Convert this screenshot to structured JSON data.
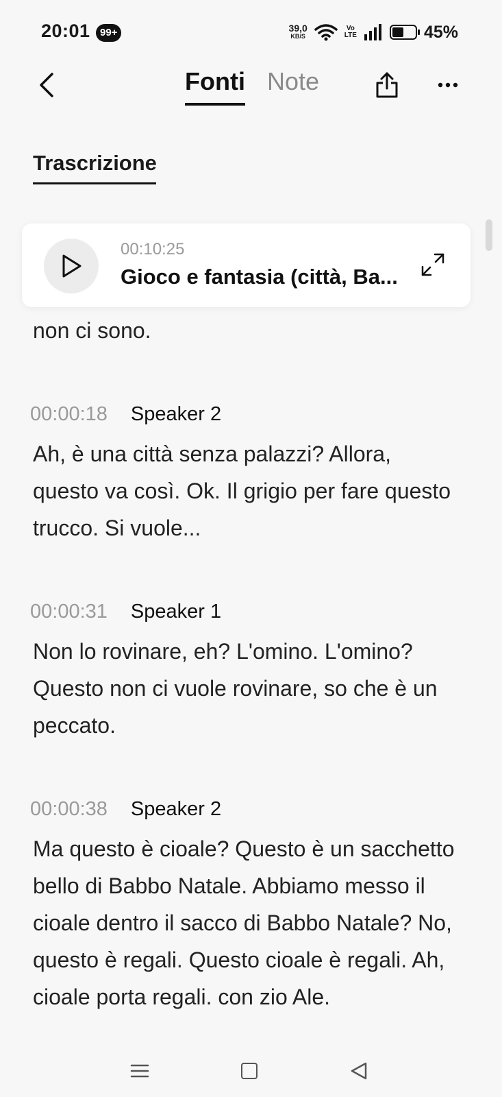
{
  "status_bar": {
    "time": "20:01",
    "badge": "99+",
    "net_speed_value": "39,0",
    "net_speed_unit": "KB/S",
    "volte_top": "Vo",
    "volte_bottom": "LTE",
    "battery_pct": "45%",
    "battery_level": 0.45
  },
  "header": {
    "tabs": [
      {
        "label": "Fonti",
        "active": true
      },
      {
        "label": "Note",
        "active": false
      }
    ]
  },
  "section": {
    "tab_label": "Trascrizione"
  },
  "player": {
    "time": "00:10:25",
    "title": "Gioco e fantasia (città, Ba..."
  },
  "transcript": {
    "partial_line": "non ci sono.",
    "segments": [
      {
        "time": "00:00:18",
        "speaker": "Speaker 2",
        "text": "Ah, è una città senza palazzi? Allora, questo va così. Ok. Il grigio per fare questo trucco. Si vuole..."
      },
      {
        "time": "00:00:31",
        "speaker": "Speaker 1",
        "text": "Non lo rovinare, eh? L'omino. L'omino? Questo non ci vuole rovinare, so che è un peccato."
      },
      {
        "time": "00:00:38",
        "speaker": "Speaker 2",
        "text": "Ma questo è cioale? Questo è un sacchetto bello di Babbo Natale. Abbiamo messo il cioale dentro il sacco di Babbo Natale? No, questo è regali. Questo cioale è regali. Ah, cioale porta regali. con zio Ale."
      }
    ]
  }
}
